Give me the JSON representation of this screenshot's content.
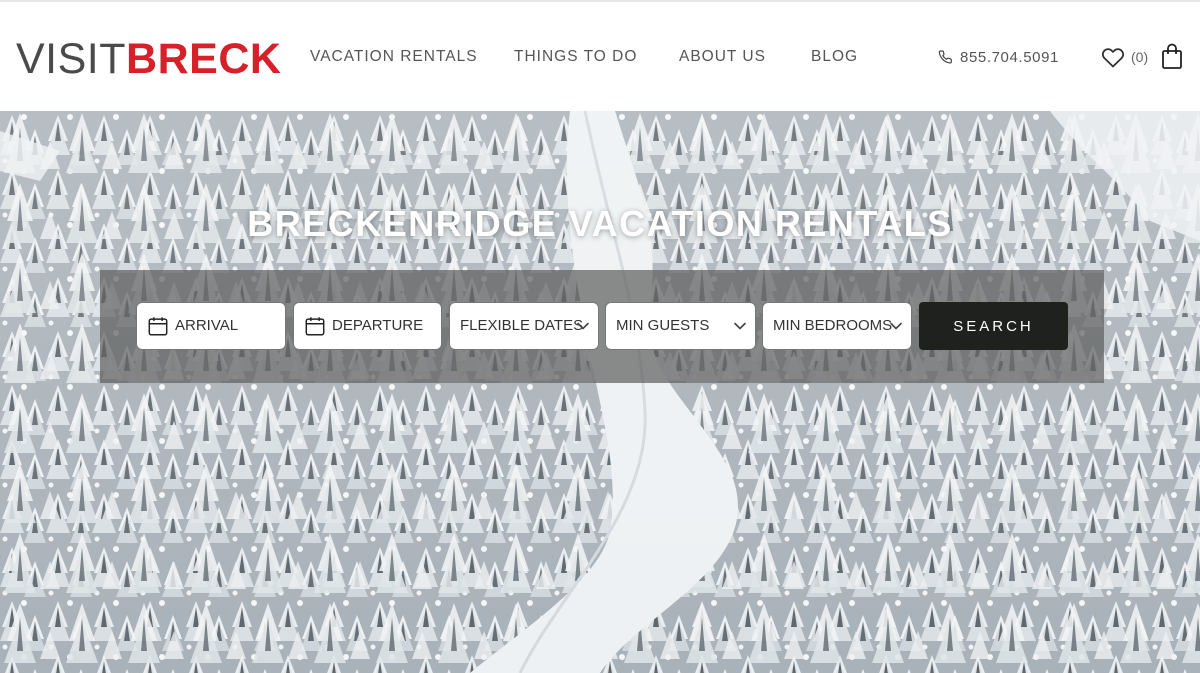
{
  "brand": {
    "logo_part1": "VISIT",
    "logo_part2": "BRECK",
    "brand_color": "#d6202a"
  },
  "nav": {
    "items": [
      "VACATION RENTALS",
      "THINGS TO DO",
      "ABOUT US",
      "BLOG"
    ]
  },
  "contact": {
    "phone": "855.704.5091",
    "phone_icon": "phone-icon"
  },
  "favorites": {
    "count_text": "(0)",
    "icon": "heart-icon"
  },
  "cart": {
    "icon": "shopping-bag-icon"
  },
  "hero": {
    "title": "BRECKENRIDGE VACATION RENTALS",
    "background": "snowy-forest-ski-run-aerial"
  },
  "search": {
    "arrival_label": "ARRIVAL",
    "departure_label": "DEPARTURE",
    "flexible_dates_label": "FLEXIBLE DATES",
    "min_guests_label": "MIN GUESTS",
    "min_bedrooms_label": "MIN BEDROOMS",
    "button_label": "SEARCH",
    "button_color": "#1e211d"
  }
}
